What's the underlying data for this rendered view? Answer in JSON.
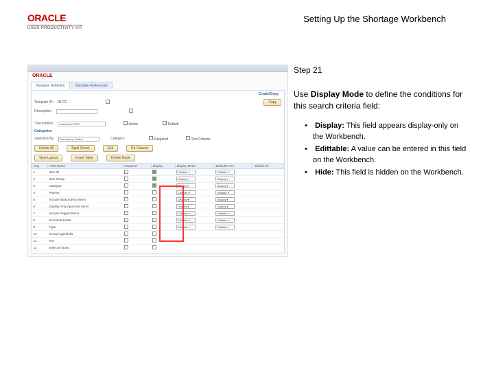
{
  "header": {
    "brand": "ORACLE",
    "product": "USER PRODUCTIVITY KIT",
    "title": "Setting Up the Shortage Workbench"
  },
  "step": "Step 21",
  "intro_pre": "Use ",
  "intro_bold": "Display Mode",
  "intro_post": " to define the conditions for this search criteria field:",
  "bullets": [
    {
      "label": "Display:",
      "text": " This field appears display-only on the Workbench."
    },
    {
      "label": "Edittable:",
      "text": " A value can be entered in this field on the Workbench."
    },
    {
      "label": "Hide:",
      "text": " This field is hidden on the Workbench."
    }
  ],
  "shot": {
    "tabs": [
      "Template Definition",
      "Template References"
    ],
    "createCopy": "Create/Copy",
    "templateId_label": "Template ID:",
    "templateId": "IN CC",
    "description_label": "Description:",
    "copy_btn": "Copy",
    "descr2_label": "*Description:",
    "descr2_val": "Inventory IT/CPV",
    "active": "Active",
    "default": "Default",
    "section": "Categories",
    "selectionBy_label": "Selection By:",
    "selectionBy": "Demand by Orders",
    "category": "Category",
    "required": "Required",
    "twoColumn": "Two Column",
    "btns": {
      "deleteAll": "Delete All",
      "spellCheck": "Spell Check",
      "exit": "Exit",
      "reColumn": "Re Column",
      "viewLayout": "View Layout",
      "insertTable": "Insert Table",
      "deleteNode": "Delete Node"
    },
    "cols": [
      "Seq",
      "Field Name",
      "Required",
      "Display",
      "Display Mode",
      "Default From",
      "Default To"
    ],
    "rows": [
      {
        "seq": "1",
        "name": "Item ID",
        "req": false,
        "disp": true,
        "mode": "Editable",
        "from": "Editable",
        "to": ""
      },
      {
        "seq": "2",
        "name": "Item Group",
        "req": false,
        "disp": true,
        "mode": "Display",
        "from": "Display",
        "to": ""
      },
      {
        "seq": "3",
        "name": "Category",
        "req": false,
        "disp": true,
        "mode": "Display",
        "from": "Display",
        "to": ""
      },
      {
        "seq": "4",
        "name": "Planner",
        "req": false,
        "disp": false,
        "mode": "Editable",
        "from": "Editable",
        "to": ""
      },
      {
        "seq": "5",
        "name": "Include Backordered Items",
        "req": false,
        "disp": false,
        "mode": "Display",
        "from": "Display",
        "to": ""
      },
      {
        "seq": "6",
        "name": "Display Only Approved Items",
        "req": false,
        "disp": false,
        "mode": "Display",
        "from": "Display",
        "to": ""
      },
      {
        "seq": "7",
        "name": "Include Pegged Items",
        "req": false,
        "disp": false,
        "mode": "Editable",
        "from": "Editable",
        "to": ""
      },
      {
        "seq": "8",
        "name": "Scheduled Date",
        "req": false,
        "disp": false,
        "mode": "Editable",
        "from": "Editable",
        "to": ""
      },
      {
        "seq": "9",
        "name": "Type",
        "req": false,
        "disp": false,
        "mode": "Editable",
        "from": "Editable",
        "to": ""
      },
      {
        "seq": "10",
        "name": "Group Hyperlinks",
        "req": false,
        "disp": false,
        "mode": "",
        "from": "",
        "to": ""
      },
      {
        "seq": "11",
        "name": "Key",
        "req": false,
        "disp": false,
        "mode": "",
        "from": "",
        "to": ""
      },
      {
        "seq": "12",
        "name": "Select In Body",
        "req": false,
        "disp": false,
        "mode": "",
        "from": "",
        "to": ""
      }
    ]
  }
}
